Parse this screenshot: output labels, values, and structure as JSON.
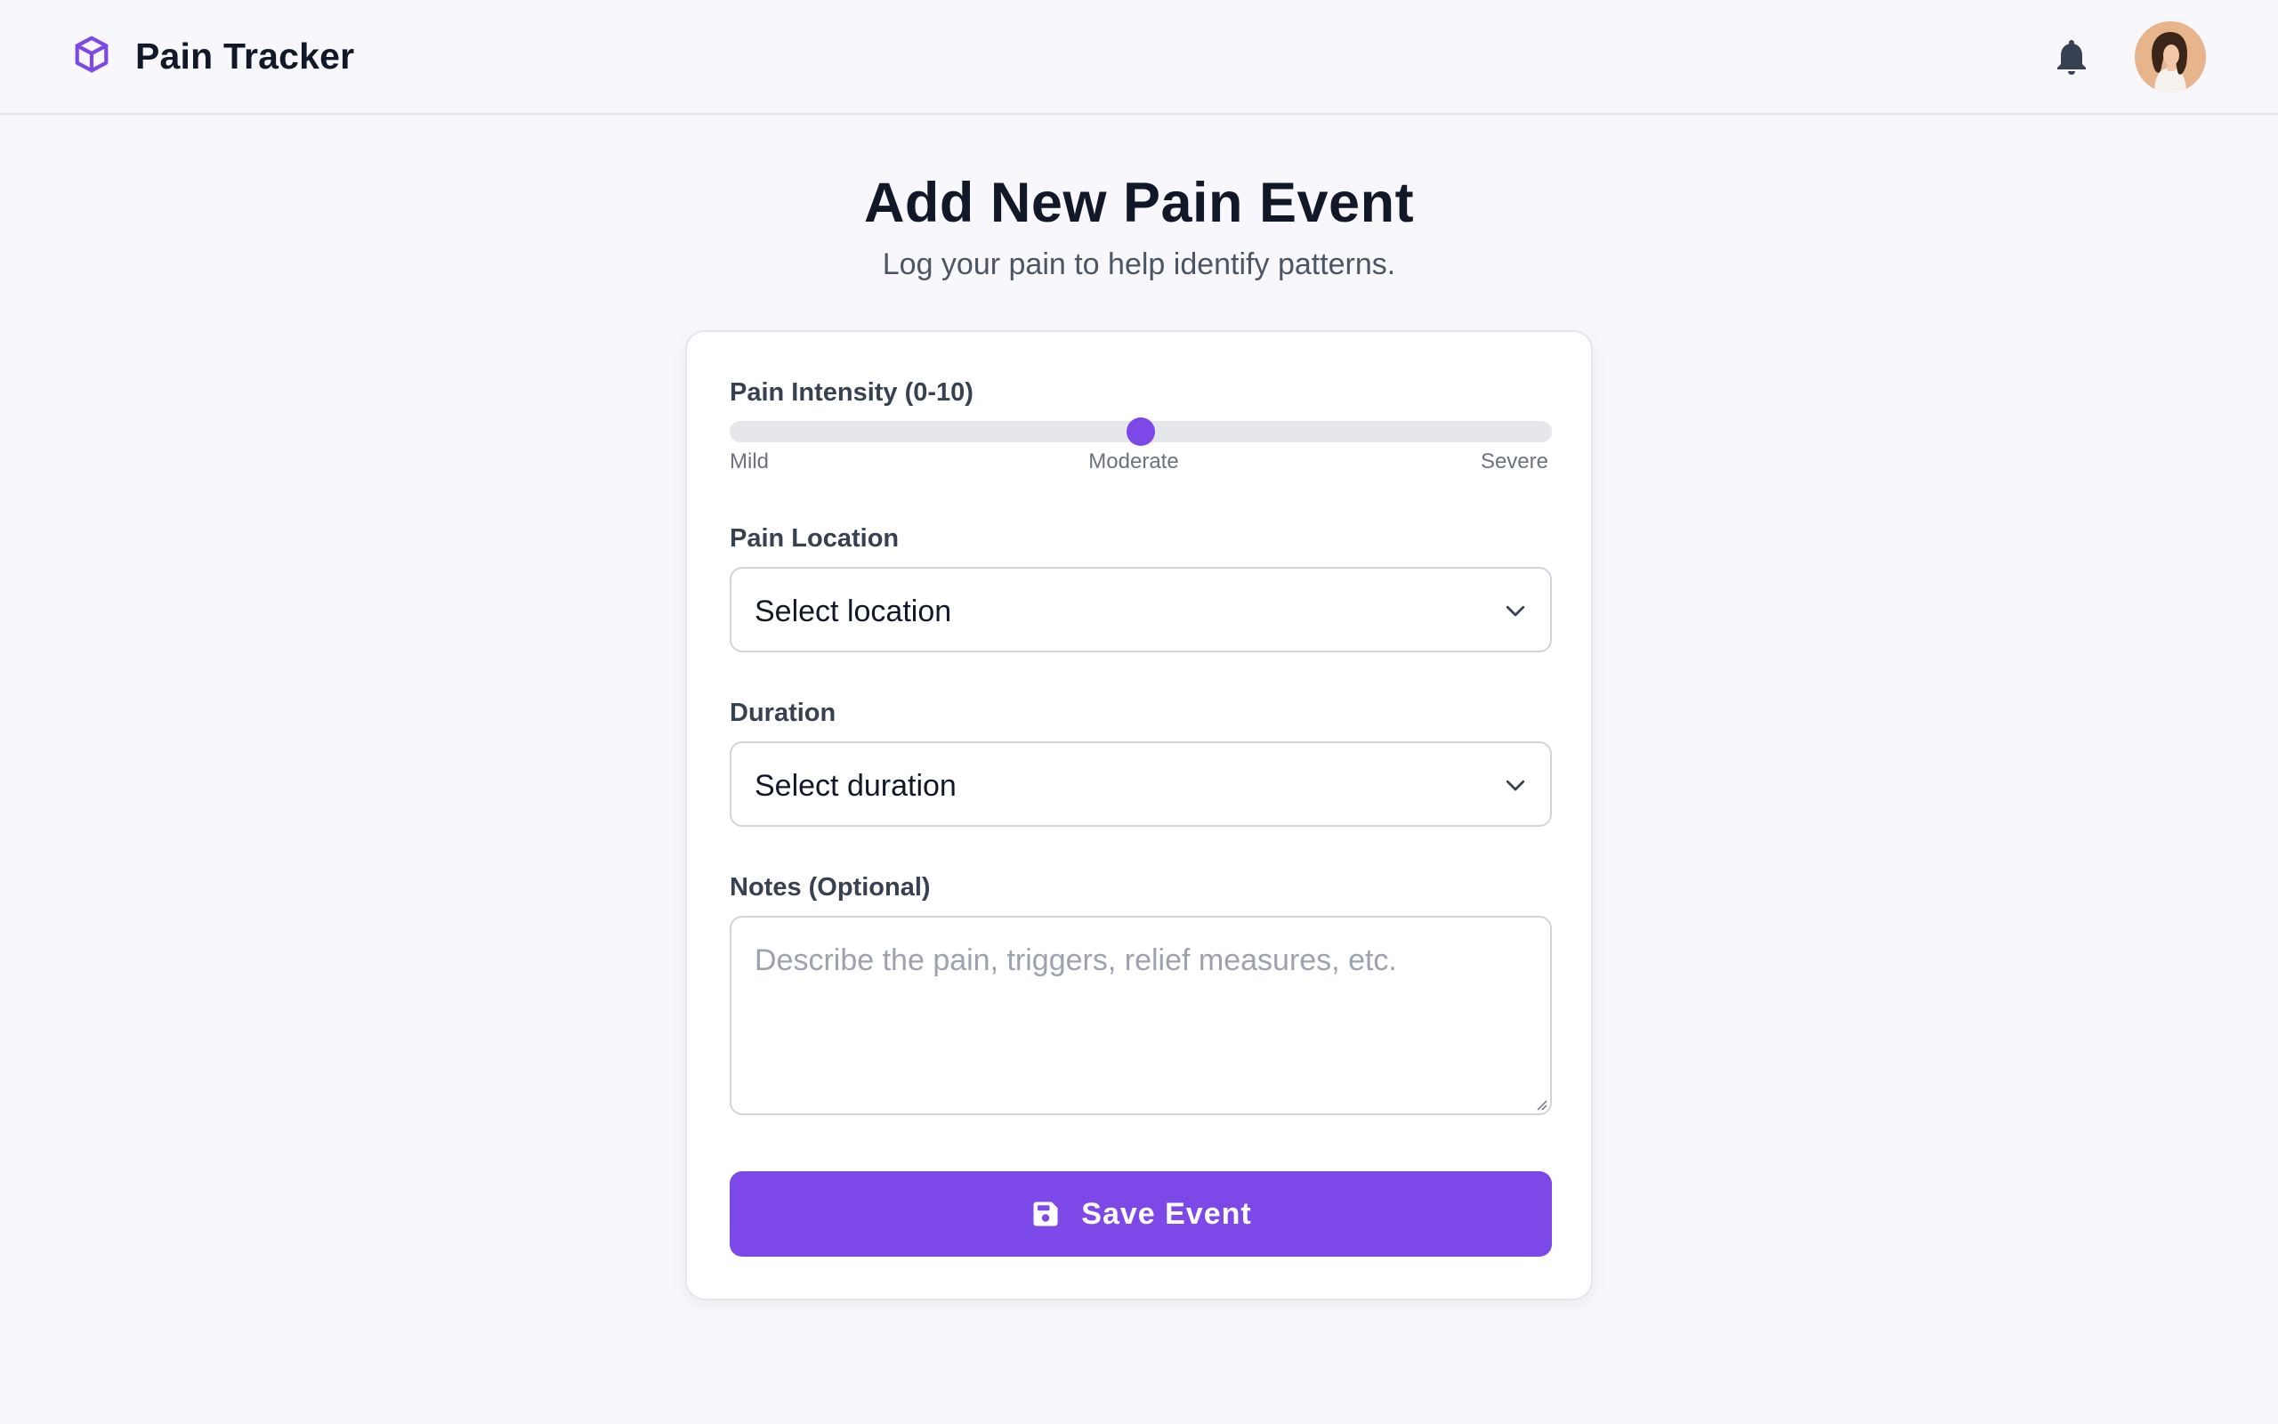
{
  "header": {
    "app_name": "Pain Tracker",
    "logo_icon": "cube-icon",
    "notification_icon": "bell-icon",
    "avatar": "user-avatar"
  },
  "page": {
    "title": "Add New Pain Event",
    "subtitle": "Log your pain to help identify patterns."
  },
  "form": {
    "intensity": {
      "label": "Pain Intensity (0-10)",
      "value": 5,
      "min": 0,
      "max": 10,
      "scale_labels": [
        "Mild",
        "Moderate",
        "Severe"
      ]
    },
    "location": {
      "label": "Pain Location",
      "value": "Select location"
    },
    "duration": {
      "label": "Duration",
      "value": "Select duration"
    },
    "notes": {
      "label": "Notes (Optional)",
      "placeholder": "Describe the pain, triggers, relief measures, etc."
    },
    "submit": {
      "label": "Save Event",
      "icon": "floppy-disk-icon"
    }
  },
  "colors": {
    "accent": "#7c48e8",
    "background": "#f8f8fc",
    "card": "#ffffff",
    "text_primary": "#111827",
    "text_secondary": "#4b5563"
  }
}
